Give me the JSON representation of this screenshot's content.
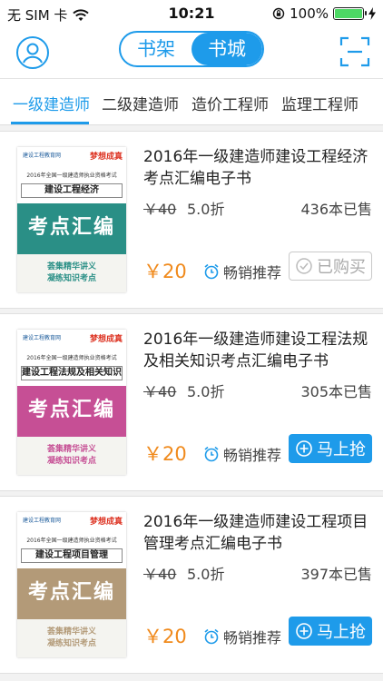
{
  "status_bar": {
    "carrier": "无 SIM 卡",
    "time": "10:21",
    "battery_percent": "100%",
    "battery_level": 1.0
  },
  "navbar": {
    "segments": [
      "书架",
      "书城"
    ],
    "active_segment": "书城",
    "icons": {
      "left": "user-avatar-icon",
      "right": "scan-frame-icon"
    },
    "accent_color": "#1e9bea"
  },
  "category_tabs": [
    "一级建造师",
    "二级建造师",
    "造价工程师",
    "监理工程师"
  ],
  "books": [
    {
      "title": "2016年一级建造师建设工程经济考点汇编电子书",
      "old_price": "￥40",
      "discount": "5.0折",
      "sold": "436本已售",
      "price": "￥20",
      "tag": "畅销推荐",
      "button": "已购买",
      "purchased": true,
      "cover": {
        "publisher": "建设工程教育网",
        "brand": "梦想成真",
        "series": "系列辅导丛书",
        "exam": "2016年全国一级建造师执业资格考试",
        "subject": "建设工程经济",
        "heading": "考点汇编",
        "tagline1": "荟集精华讲义",
        "tagline2": "凝练知识考点",
        "band_color": "#2a8f86",
        "tagline_color": "#2a8f86"
      }
    },
    {
      "title": "2016年一级建造师建设工程法规及相关知识考点汇编电子书",
      "old_price": "￥40",
      "discount": "5.0折",
      "sold": "305本已售",
      "price": "￥20",
      "tag": "畅销推荐",
      "button": "马上抢",
      "purchased": false,
      "cover": {
        "publisher": "建设工程教育网",
        "brand": "梦想成真",
        "series": "系列辅导丛书",
        "exam": "2016年全国一级建造师执业资格考试",
        "subject": "建设工程法规及相关知识",
        "heading": "考点汇编",
        "tagline1": "荟集精华讲义",
        "tagline2": "凝练知识考点",
        "band_color": "#c64f95",
        "tagline_color": "#c64f95"
      }
    },
    {
      "title": "2016年一级建造师建设工程项目管理考点汇编电子书",
      "old_price": "￥40",
      "discount": "5.0折",
      "sold": "397本已售",
      "price": "￥20",
      "tag": "畅销推荐",
      "button": "马上抢",
      "purchased": false,
      "cover": {
        "publisher": "建设工程教育网",
        "brand": "梦想成真",
        "series": "系列辅导丛书",
        "exam": "2016年全国一级建造师执业资格考试",
        "subject": "建设工程项目管理",
        "heading": "考点汇编",
        "tagline1": "荟集精华讲义",
        "tagline2": "凝练知识考点",
        "band_color": "#b39a78",
        "tagline_color": "#b39a78"
      }
    }
  ]
}
